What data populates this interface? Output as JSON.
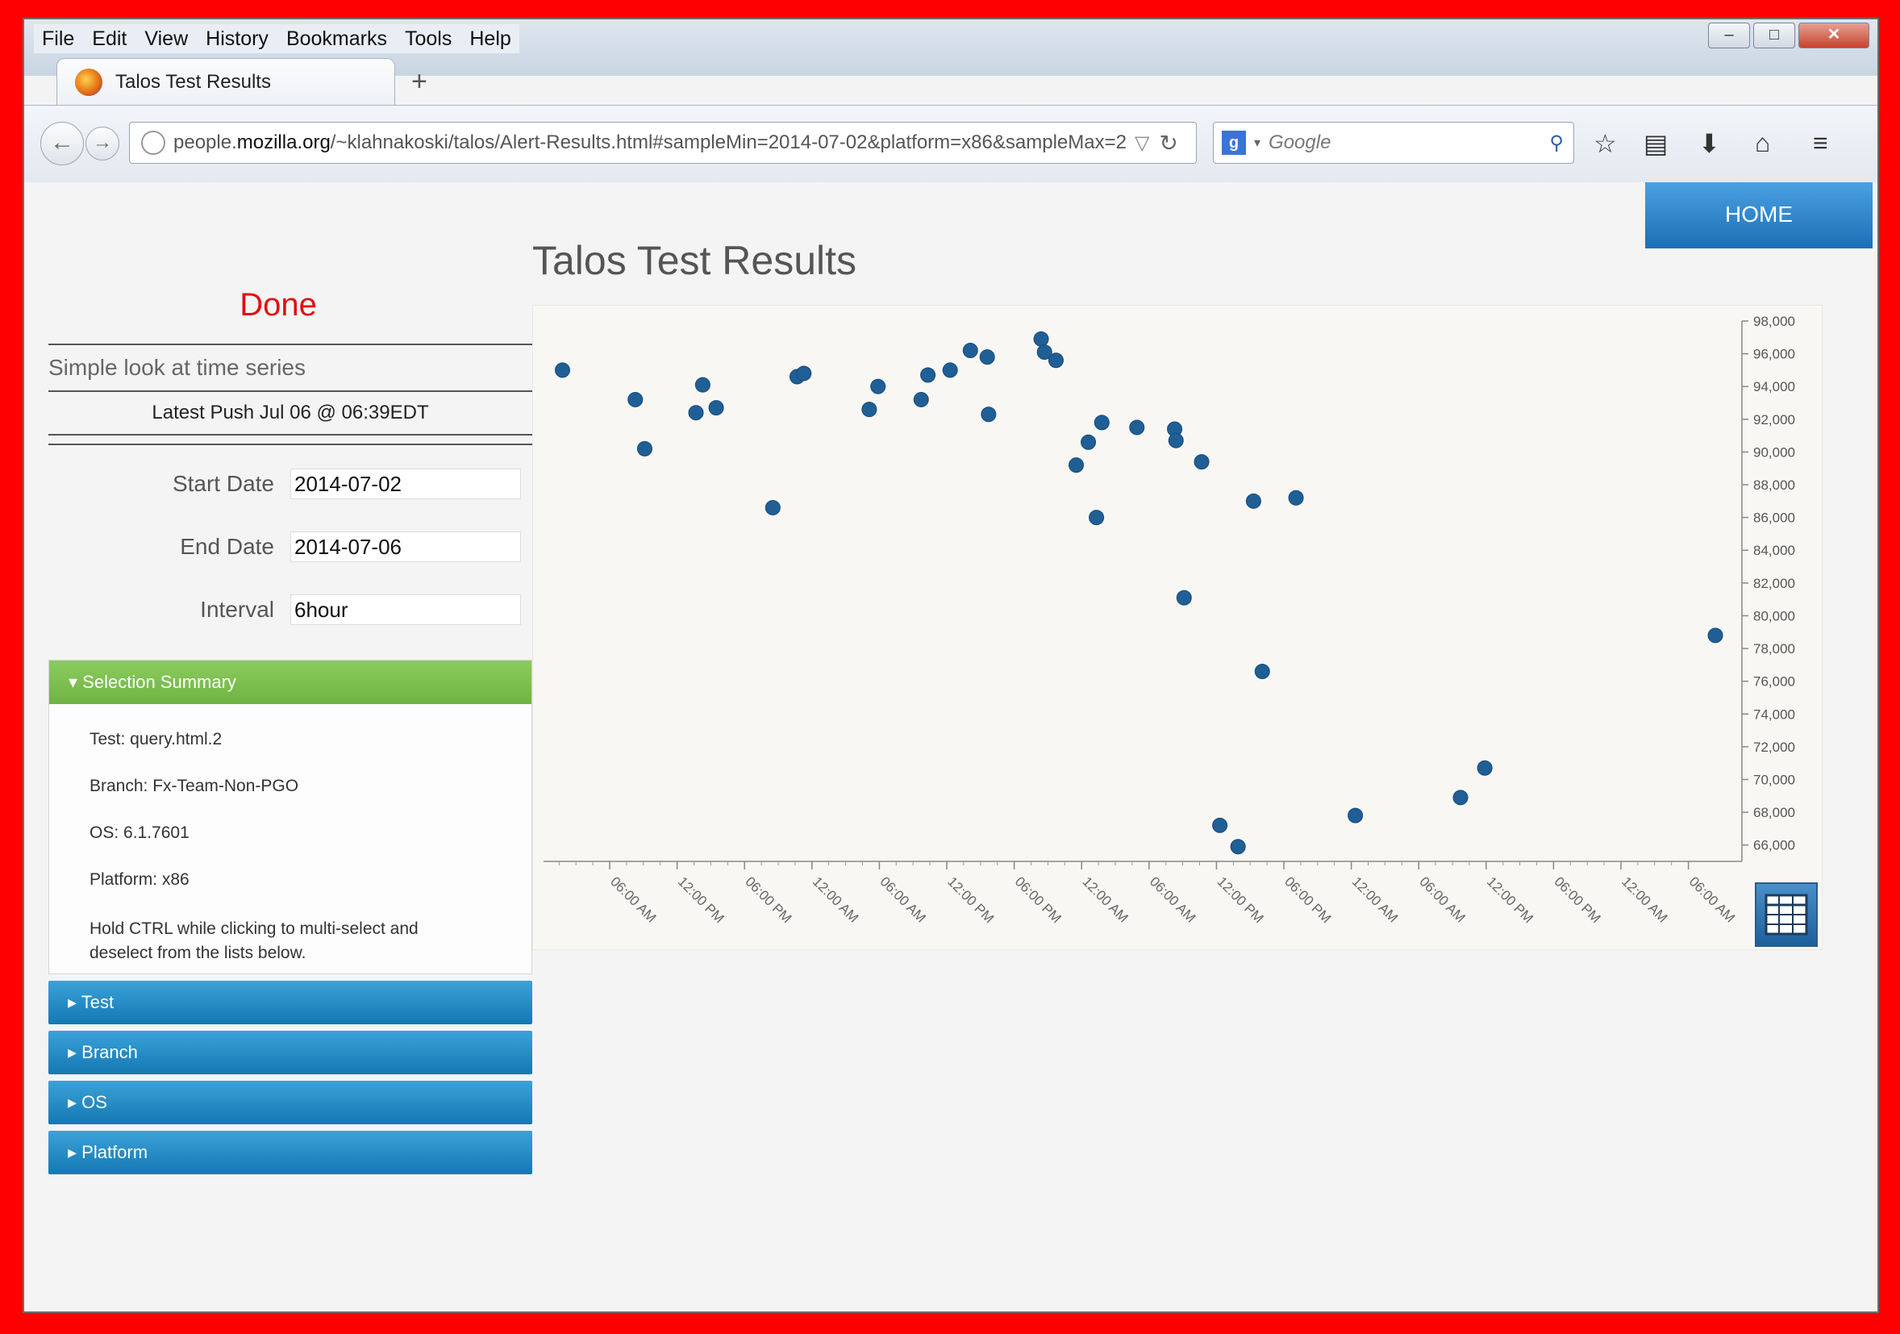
{
  "browser": {
    "menu": [
      "File",
      "Edit",
      "View",
      "History",
      "Bookmarks",
      "Tools",
      "Help"
    ],
    "tab_title": "Talos Test Results",
    "url_prefix": "people.",
    "url_domain": "mozilla.org",
    "url_rest": "/~klahnakoski/talos/Alert-Results.html#sampleMin=2014-07-02&platform=x86&sampleMax=2",
    "search_placeholder": "Google"
  },
  "page": {
    "home_label": "HOME",
    "title": "Talos Test Results",
    "status": "Done",
    "description": "Simple look at time series",
    "latest_push": "Latest Push Jul 06 @ 06:39EDT",
    "start_label": "Start Date",
    "start_value": "2014-07-02",
    "end_label": "End Date",
    "end_value": "2014-07-06",
    "interval_label": "Interval",
    "interval_value": "6hour",
    "summary_title": "Selection Summary",
    "summary_test": "Test: query.html.2",
    "summary_branch": "Branch: Fx-Team-Non-PGO",
    "summary_os": "OS: 6.1.7601",
    "summary_platform": "Platform: x86",
    "summary_hint": "Hold CTRL while clicking to multi-select and deselect from the lists below.",
    "accordion": [
      "Test",
      "Branch",
      "OS",
      "Platform"
    ]
  },
  "chart_data": {
    "type": "scatter",
    "title": "",
    "xlabel": "",
    "ylabel": "",
    "ylim": [
      65000,
      98000
    ],
    "y_ticks": [
      "98,000",
      "96,000",
      "94,000",
      "92,000",
      "90,000",
      "88,000",
      "86,000",
      "84,000",
      "82,000",
      "80,000",
      "78,000",
      "76,000",
      "74,000",
      "72,000",
      "70,000",
      "68,000",
      "66,000"
    ],
    "x_ticks": [
      "06:00 AM",
      "12:00 PM",
      "06:00 PM",
      "12:00 AM",
      "06:00 AM",
      "12:00 PM",
      "06:00 PM",
      "12:00 AM",
      "06:00 AM",
      "12:00 PM",
      "06:00 PM",
      "12:00 AM",
      "06:00 AM",
      "12:00 PM",
      "06:00 PM",
      "12:00 AM",
      "06:00 AM"
    ],
    "color": "#1f5f96",
    "points": [
      [
        0.3,
        95000
      ],
      [
        1.38,
        93200
      ],
      [
        1.52,
        90200
      ],
      [
        2.28,
        92400
      ],
      [
        2.38,
        94100
      ],
      [
        2.58,
        92700
      ],
      [
        3.42,
        86600
      ],
      [
        3.78,
        94600
      ],
      [
        3.88,
        94800
      ],
      [
        4.85,
        92600
      ],
      [
        4.98,
        94000
      ],
      [
        5.62,
        93200
      ],
      [
        5.72,
        94700
      ],
      [
        6.05,
        95000
      ],
      [
        6.35,
        96200
      ],
      [
        6.6,
        95800
      ],
      [
        6.62,
        92300
      ],
      [
        7.4,
        96900
      ],
      [
        7.45,
        96100
      ],
      [
        7.62,
        95600
      ],
      [
        7.92,
        89200
      ],
      [
        8.1,
        90600
      ],
      [
        8.22,
        86000
      ],
      [
        8.3,
        91800
      ],
      [
        8.82,
        91500
      ],
      [
        9.38,
        91400
      ],
      [
        9.4,
        90700
      ],
      [
        9.52,
        81100
      ],
      [
        9.78,
        89400
      ],
      [
        10.05,
        67200
      ],
      [
        10.32,
        65900
      ],
      [
        10.55,
        87000
      ],
      [
        10.68,
        76600
      ],
      [
        11.18,
        87200
      ],
      [
        12.06,
        67800
      ],
      [
        13.62,
        68900
      ],
      [
        13.98,
        70700
      ],
      [
        17.4,
        78800
      ]
    ]
  }
}
